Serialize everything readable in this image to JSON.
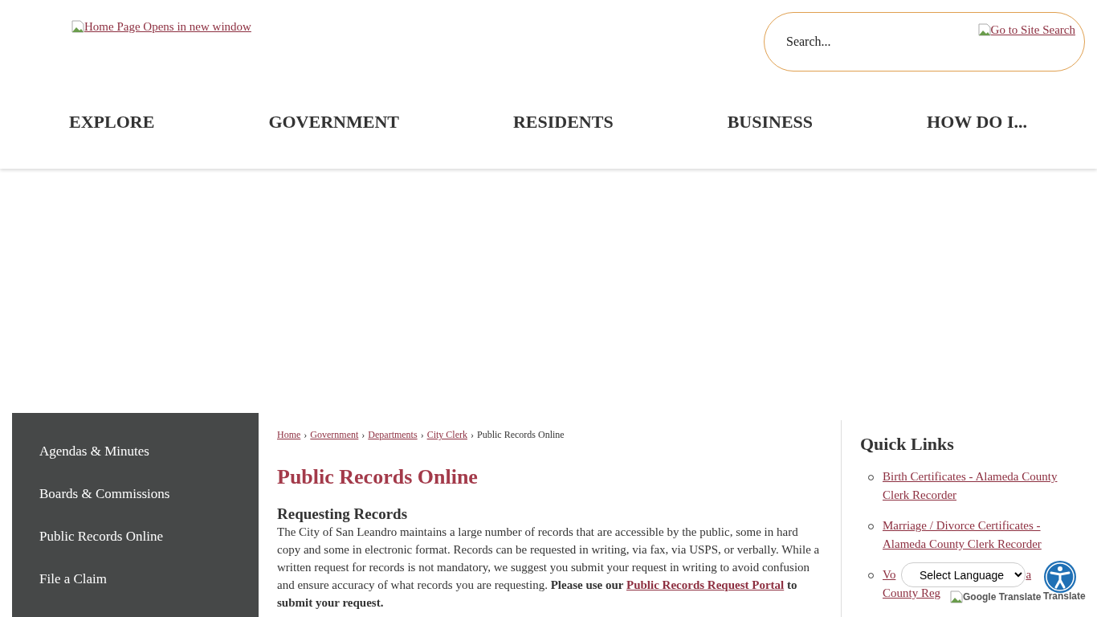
{
  "header": {
    "logo_alt": "Home Page Opens in new window",
    "search": {
      "placeholder": "Search...",
      "button_alt": "Go to Site Search"
    }
  },
  "nav": [
    "EXPLORE",
    "GOVERNMENT",
    "RESIDENTS",
    "BUSINESS",
    "HOW DO I..."
  ],
  "sidebar": {
    "items": [
      {
        "label": "Agendas & Minutes"
      },
      {
        "label": "Boards & Commissions"
      },
      {
        "label": "Public Records Online"
      },
      {
        "label": "File a Claim"
      }
    ]
  },
  "breadcrumb": {
    "links": [
      "Home",
      "Government",
      "Departments",
      "City Clerk"
    ],
    "separator": "›",
    "current": "Public Records Online"
  },
  "page_title": "Public Records Online",
  "section": {
    "heading": "Requesting Records",
    "text": "The City of San Leandro maintains a large number of records that are accessible by the public, some in hard copy and some in electronic format. Records can be requested in writing, via fax, via USPS, or verbally. While a written request for records is not mandatory, we suggest you submit your request in writing to avoid confusion and ensure accuracy of what records you are requesting. ",
    "bold_before": "Please use our ",
    "link": "Public Records Request Portal",
    "bold_after": " to submit your request."
  },
  "quick_links": {
    "title": "Quick Links",
    "items": [
      {
        "lines": [
          "Birth Certificates - Alameda County",
          "Clerk Recorder"
        ]
      },
      {
        "lines": [
          "Marriage / Divorce Certificates -",
          "Alameda County Clerk Recorder"
        ]
      },
      {
        "lines": [
          "Vo",
          "a",
          "County Reg"
        ]
      }
    ]
  },
  "translate": {
    "select": "Select Language",
    "image_alt": "Google Translate",
    "label": "Translate"
  }
}
